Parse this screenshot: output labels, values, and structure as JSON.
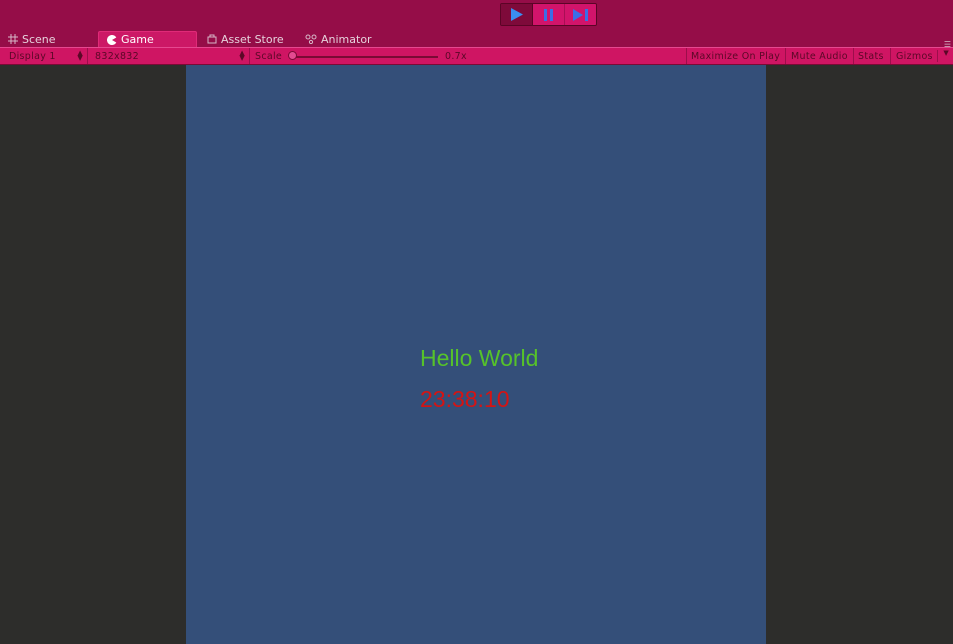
{
  "play_controls": {
    "play_icon": "play-icon",
    "pause_icon": "pause-icon",
    "step_icon": "step-icon"
  },
  "tabs": [
    {
      "label": "Scene",
      "icon": "grid-icon"
    },
    {
      "label": "Game",
      "icon": "pacman-icon",
      "active": true
    },
    {
      "label": "Asset Store",
      "icon": "store-icon"
    },
    {
      "label": "Animator",
      "icon": "animator-icon"
    }
  ],
  "toolbar": {
    "display": "Display 1",
    "resolution": "832x832",
    "scale_label": "Scale",
    "scale_value": "0.7x",
    "scale_level": 0.0,
    "maximize_on_play": "Maximize On Play",
    "mute_audio": "Mute Audio",
    "stats": "Stats",
    "gizmos": "Gizmos"
  },
  "game": {
    "hello_text": "Hello World",
    "clock_text": "23:38:10"
  },
  "colors": {
    "title_bar": "#950d48",
    "toolbar": "#cf1563",
    "game_background": "#344f79",
    "hello_text": "#56c22a",
    "clock_text": "#d41414",
    "editor_background": "#2d2d2b"
  }
}
